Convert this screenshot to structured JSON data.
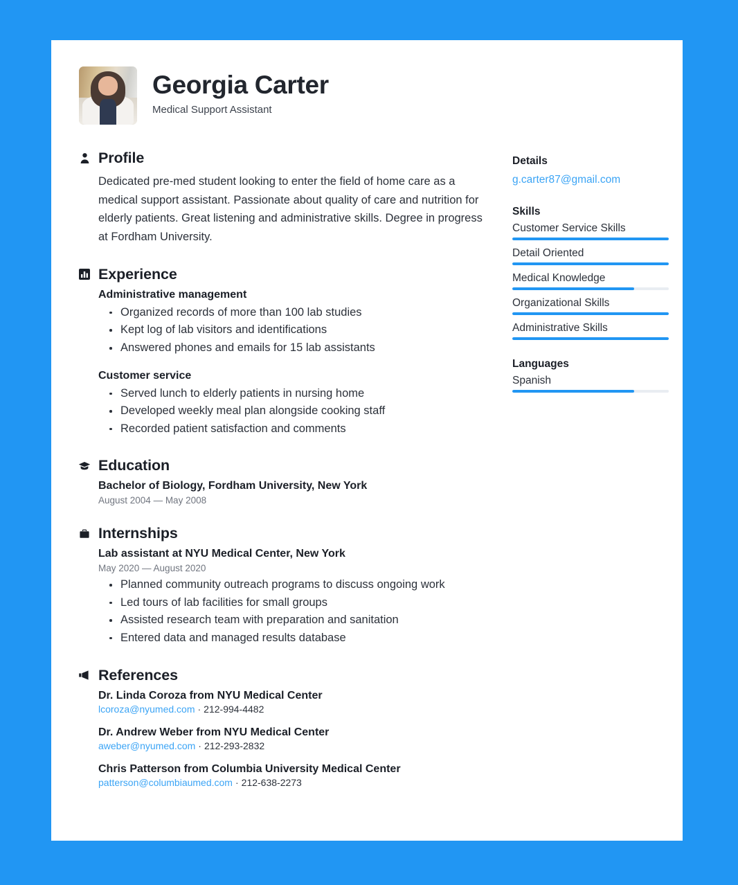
{
  "theme": {
    "background": "#2196f3",
    "paper": "#ffffff",
    "accent": "#2196f3",
    "link": "#3ba4f5",
    "heading": "#1b1f27",
    "text": "#2c313a",
    "muted": "#70757f",
    "bar_track": "#e9edf2"
  },
  "header": {
    "name": "Georgia Carter",
    "job_title": "Medical Support Assistant",
    "avatar_alt": "portrait-photo"
  },
  "sections": {
    "profile": {
      "title": "Profile",
      "icon": "person-icon",
      "text": "Dedicated pre-med student looking to enter the field of home care as a medical support assistant. Passionate about quality of care and nutrition for elderly patients. Great listening and administrative skills. Degree in progress at Fordham University."
    },
    "experience": {
      "title": "Experience",
      "icon": "bar-chart-icon",
      "entries": [
        {
          "title": "Administrative management",
          "bullets": [
            "Organized records of more than 100 lab studies",
            "Kept log of lab visitors and identifications",
            "Answered phones and emails for 15 lab assistants"
          ]
        },
        {
          "title": "Customer service",
          "bullets": [
            "Served lunch to elderly patients in nursing home",
            "Developed weekly meal plan alongside cooking staff",
            "Recorded patient satisfaction and comments"
          ]
        }
      ]
    },
    "education": {
      "title": "Education",
      "icon": "graduation-cap-icon",
      "entries": [
        {
          "title": "Bachelor of Biology, Fordham University, New York",
          "date": "August 2004 — May 2008"
        }
      ]
    },
    "internships": {
      "title": "Internships",
      "icon": "briefcase-icon",
      "entries": [
        {
          "title": "Lab assistant at NYU Medical Center, New York",
          "date": "May 2020 — August 2020",
          "bullets": [
            "Planned community outreach programs to discuss ongoing work",
            "Led tours of lab facilities for small groups",
            "Assisted research team with preparation and sanitation",
            "Entered data and managed results database"
          ]
        }
      ]
    },
    "references": {
      "title": "References",
      "icon": "megaphone-icon",
      "entries": [
        {
          "name": "Dr. Linda Coroza from NYU Medical Center",
          "email": "lcoroza@nyumed.com",
          "separator": "·",
          "phone": "212-994-4482"
        },
        {
          "name": "Dr. Andrew Weber from NYU Medical Center",
          "email": "aweber@nyumed.com",
          "separator": "·",
          "phone": "212-293-2832"
        },
        {
          "name": "Chris Patterson from Columbia University Medical Center",
          "email": "patterson@columbiaumed.com",
          "separator": "·",
          "phone": "212-638-2273"
        }
      ]
    }
  },
  "sidebar": {
    "details": {
      "title": "Details",
      "email": "g.carter87@gmail.com"
    },
    "skills": {
      "title": "Skills",
      "items": [
        {
          "label": "Customer Service Skills",
          "level": 100
        },
        {
          "label": "Detail Oriented",
          "level": 100
        },
        {
          "label": "Medical Knowledge",
          "level": 78
        },
        {
          "label": "Organizational Skills",
          "level": 100
        },
        {
          "label": "Administrative Skills",
          "level": 100
        }
      ]
    },
    "languages": {
      "title": "Languages",
      "items": [
        {
          "label": "Spanish",
          "level": 78
        }
      ]
    }
  }
}
